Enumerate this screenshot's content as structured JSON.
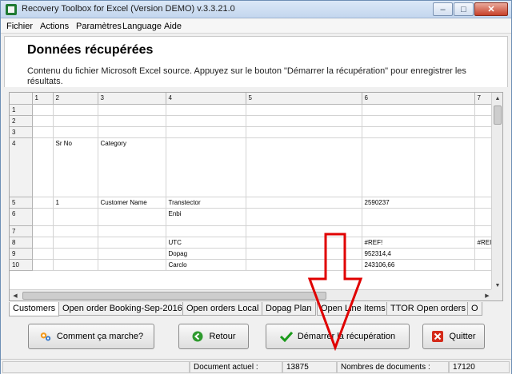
{
  "window": {
    "title": "Recovery Toolbox for Excel (Version DEMO) v.3.3.21.0",
    "minimize_label": "–",
    "maximize_label": "□",
    "close_label": "✕"
  },
  "menu": [
    "Fichier",
    "Actions",
    "Paramètres",
    "Language",
    "Aide"
  ],
  "header": {
    "title": "Données récupérées",
    "description": "Contenu du fichier Microsoft Excel source. Appuyez sur le bouton \"Démarrer la récupération\" pour enregistrer les résultats."
  },
  "grid": {
    "columns": [
      "",
      "1",
      "2",
      "3",
      "4",
      "5",
      "6",
      "7"
    ],
    "rows": [
      {
        "num": "1",
        "cells": [
          "",
          "",
          "",
          "",
          "",
          "",
          ""
        ]
      },
      {
        "num": "2",
        "cells": [
          "",
          "",
          "",
          "",
          "",
          "",
          ""
        ]
      },
      {
        "num": "3",
        "cells": [
          "",
          "",
          "",
          "",
          "",
          "",
          ""
        ]
      },
      {
        "num": "4",
        "cells": [
          "",
          "Sr No",
          "Category",
          "",
          "",
          "",
          ""
        ]
      },
      {
        "num": "5",
        "cells": [
          "",
          "1",
          "Customer Name",
          "Transtector",
          "",
          "2590237",
          ""
        ]
      },
      {
        "num": "6",
        "cells": [
          "",
          "",
          "",
          "Enbi",
          "",
          "",
          ""
        ]
      },
      {
        "num": "7",
        "cells": [
          "",
          "",
          "",
          "",
          "",
          "",
          ""
        ]
      },
      {
        "num": "8",
        "cells": [
          "",
          "",
          "",
          "UTC",
          "",
          "#REF!",
          "#REI"
        ]
      },
      {
        "num": "9",
        "cells": [
          "",
          "",
          "",
          "Dopag",
          "",
          "952314,4",
          ""
        ]
      },
      {
        "num": "10",
        "cells": [
          "",
          "",
          "",
          "Carclo",
          "",
          "243106,66",
          ""
        ]
      }
    ]
  },
  "sheet_tabs": [
    "Customers",
    "Open order Booking-Sep-2016",
    "Open orders Local",
    "Dopag Plan",
    "Open Line Items",
    "TTOR Open orders",
    "O"
  ],
  "buttons": {
    "how_it_works": "Comment ça marche?",
    "back": "Retour",
    "start": "Démarrer la récupération",
    "quit": "Quitter"
  },
  "status": {
    "current_doc_label": "Document actuel :",
    "current_doc_value": "13875",
    "doc_count_label": "Nombres de documents :",
    "doc_count_value": "17120"
  },
  "colors": {
    "arrow": "#e00000",
    "back_icon": "#2e9a2e",
    "start_icon": "#1a9a1a",
    "quit_icon": "#d42a1a",
    "gear_orange": "#f39a1e",
    "gear_blue": "#3a7ac9"
  }
}
